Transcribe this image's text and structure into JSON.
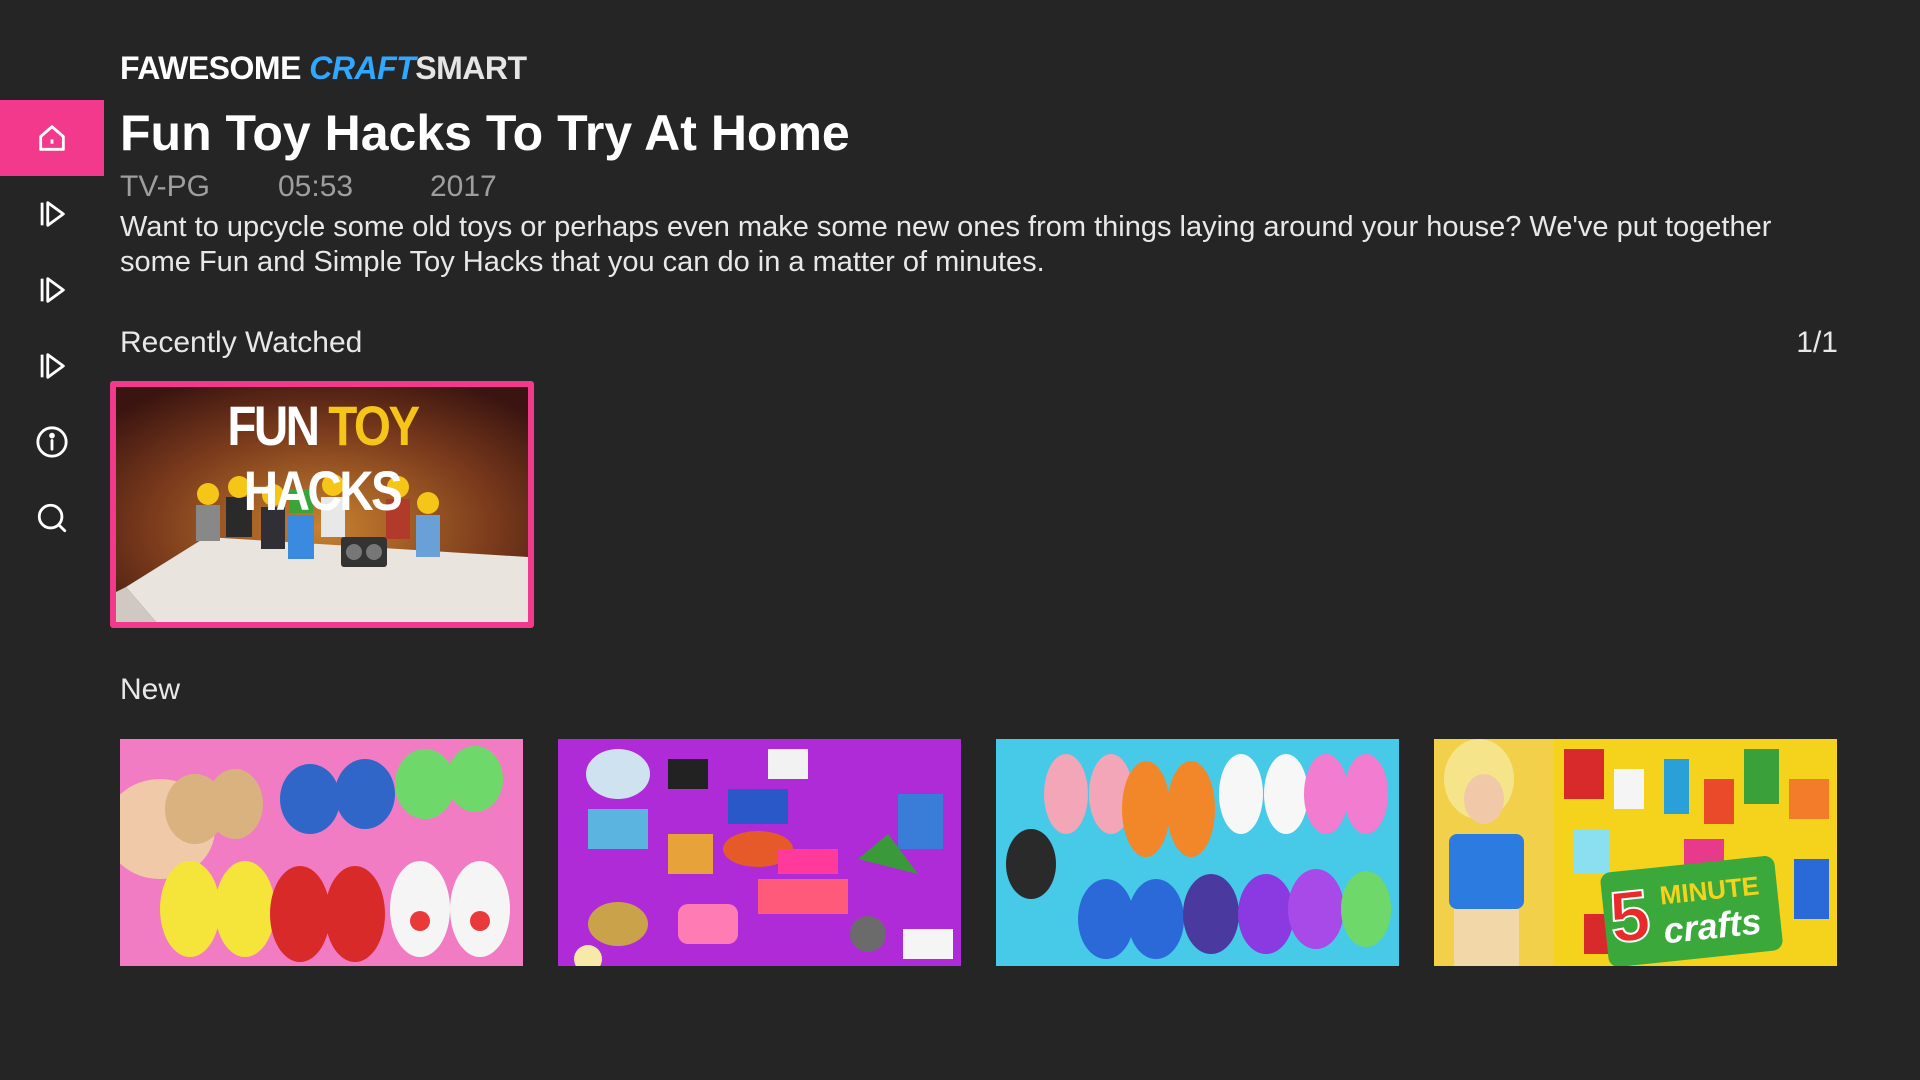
{
  "brand": {
    "part1": "FAWESOME",
    "part2": "CRAFT",
    "part3": "SMART"
  },
  "sidebar": {
    "items": [
      {
        "icon": "home-icon",
        "active": true
      },
      {
        "icon": "play-icon"
      },
      {
        "icon": "play-icon"
      },
      {
        "icon": "play-icon"
      },
      {
        "icon": "info-icon"
      },
      {
        "icon": "search-icon"
      }
    ]
  },
  "featured": {
    "title": "Fun Toy Hacks To Try At Home",
    "rating": "TV-PG",
    "duration": "05:53",
    "year": "2017",
    "description": "Want to upcycle some old toys or perhaps even make some new ones from things laying around your house? We've put together some Fun and Simple Toy Hacks that you can do in a matter of minutes."
  },
  "rows": {
    "recently_watched": {
      "label": "Recently Watched",
      "page": "1/1",
      "items": [
        {
          "thumb_text_1": "FUN",
          "thumb_text_2": "TOY",
          "thumb_text_3": "HACKS"
        }
      ]
    },
    "new": {
      "label": "New",
      "items": [
        {
          "thumb_text": ""
        },
        {
          "thumb_text": ""
        },
        {
          "thumb_text": ""
        },
        {
          "thumb_text_1": "5",
          "thumb_text_2": "MINUTE",
          "thumb_text_3": "crafts"
        }
      ]
    }
  },
  "colors": {
    "accent": "#f2398c",
    "background": "#252526",
    "brand_blue": "#2fa9ff"
  }
}
